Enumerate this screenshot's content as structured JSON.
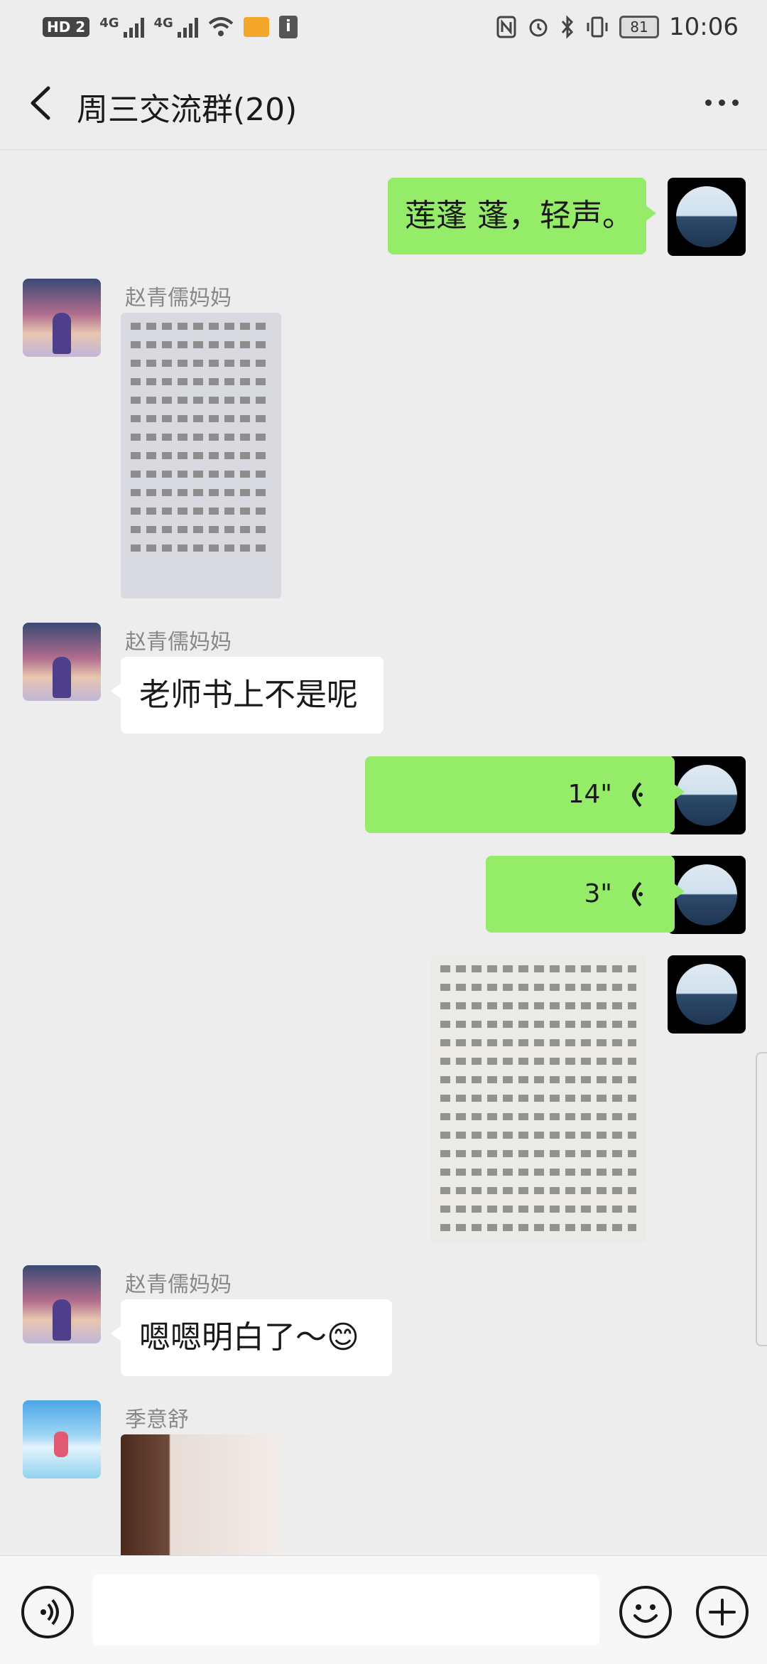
{
  "status_bar": {
    "left": [
      "HD 2",
      "4G",
      "4G"
    ],
    "battery": "81",
    "time": "10:06"
  },
  "header": {
    "title": "周三交流群(20)"
  },
  "colors": {
    "green_bubble": "#95ec69",
    "white_bubble": "#ffffff",
    "background": "#ededed"
  },
  "messages": [
    {
      "side": "right",
      "type": "text",
      "text": "莲蓬  蓬，轻声。"
    },
    {
      "side": "left",
      "type": "image",
      "sender": "赵青儒妈妈",
      "image": "textbook-photo"
    },
    {
      "side": "left",
      "type": "text",
      "sender": "赵青儒妈妈",
      "text": "老师书上不是呢"
    },
    {
      "side": "right",
      "type": "voice",
      "duration": "14\""
    },
    {
      "side": "right",
      "type": "voice",
      "duration": "3\""
    },
    {
      "side": "right",
      "type": "image",
      "image": "dictionary-photo"
    },
    {
      "side": "left",
      "type": "text",
      "sender": "赵青儒妈妈",
      "text": "嗯嗯明白了～😊"
    },
    {
      "side": "left",
      "type": "image",
      "sender": "季意舒",
      "image": "room-photo"
    }
  ],
  "input_bar": {
    "voice_button": "voice-icon",
    "emoji_button": "emoji-icon",
    "add_button": "plus-icon"
  }
}
